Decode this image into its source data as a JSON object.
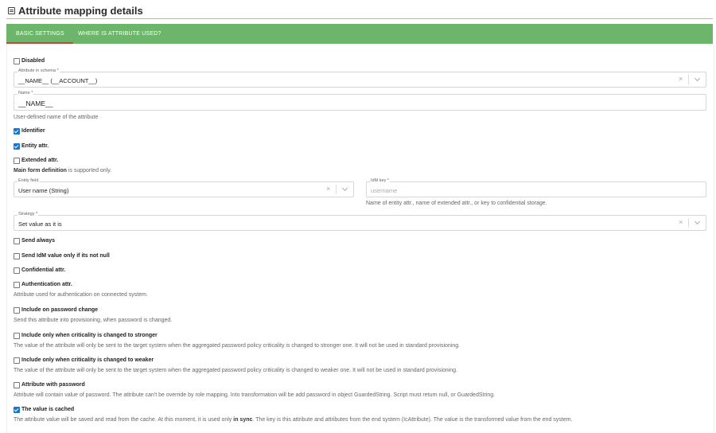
{
  "page": {
    "title": "Attribute mapping details"
  },
  "tabs": [
    {
      "label": "BASIC SETTINGS",
      "active": true
    },
    {
      "label": "WHERE IS ATTRIBUTE USED?",
      "active": false
    }
  ],
  "colors": {
    "tab_bar": "#6db56b",
    "tab_active_underline": "#d23f3f",
    "checkbox_checked": "#1976d2"
  },
  "form": {
    "disabled": {
      "label": "Disabled",
      "checked": false
    },
    "schema_attribute": {
      "label": "Attribute in schema *",
      "value": "__NAME__ (__ACCOUNT__)"
    },
    "name": {
      "label": "Name *",
      "value": "__NAME__",
      "help": "User-defined name of the attribute"
    },
    "identifier": {
      "label": "Identifier",
      "checked": true
    },
    "entity_attr": {
      "label": "Entity attr.",
      "checked": true
    },
    "extended_attr": {
      "label": "Extended attr.",
      "checked": false,
      "help_bold": "Main form definition",
      "help_rest": " is supported only."
    },
    "entity_field": {
      "label": "Entity field",
      "value": "User name (String)"
    },
    "idm_key": {
      "label": "IdM key *",
      "placeholder": "username",
      "help": "Name of entity attr., name of extended attr., or key to confidential storage."
    },
    "strategy": {
      "label": "Strategy *",
      "value": "Set value as it is"
    },
    "send_always": {
      "label": "Send always",
      "checked": false
    },
    "send_only_if_not_null": {
      "label": "Send IdM value only if its not null",
      "checked": false
    },
    "confidential": {
      "label": "Confidential attr.",
      "checked": false
    },
    "authentication": {
      "label": "Authentication attr.",
      "checked": false,
      "help": "Attribute used for authentication on connected system."
    },
    "password_change": {
      "label": "Include on password change",
      "checked": false,
      "help": "Send this attribute into provisioning, when password is changed."
    },
    "criticality_stronger": {
      "label": "Include only when criticality is changed to stronger",
      "checked": false,
      "help": "The value of the attribute will only be sent to the target system when the aggregated password policy criticality is changed to stronger one. It will not be used in standard provisioning."
    },
    "criticality_weaker": {
      "label": "Include only when criticality is changed to weaker",
      "checked": false,
      "help": "The value of the attribute will only be sent to the target system when the aggregated password policy criticality is changed to weaker one. It will not be used in standard provisioning."
    },
    "with_password": {
      "label": "Attribute with password",
      "checked": false,
      "help": "Attribute will contain value of password. The attribute can't be override by role mapping. Into transformation will be add password in object GuardedString. Script must return null, or GuardedString."
    },
    "cached": {
      "label": "The value is cached",
      "checked": true,
      "help_pre": "The attribute value will be saved and read from the cache. At this moment, it is used only ",
      "help_bold": "in sync",
      "help_post": ". The key is this attribute and attributes from the end system (IcAttribute). The value is the transformed value from the end system."
    }
  }
}
